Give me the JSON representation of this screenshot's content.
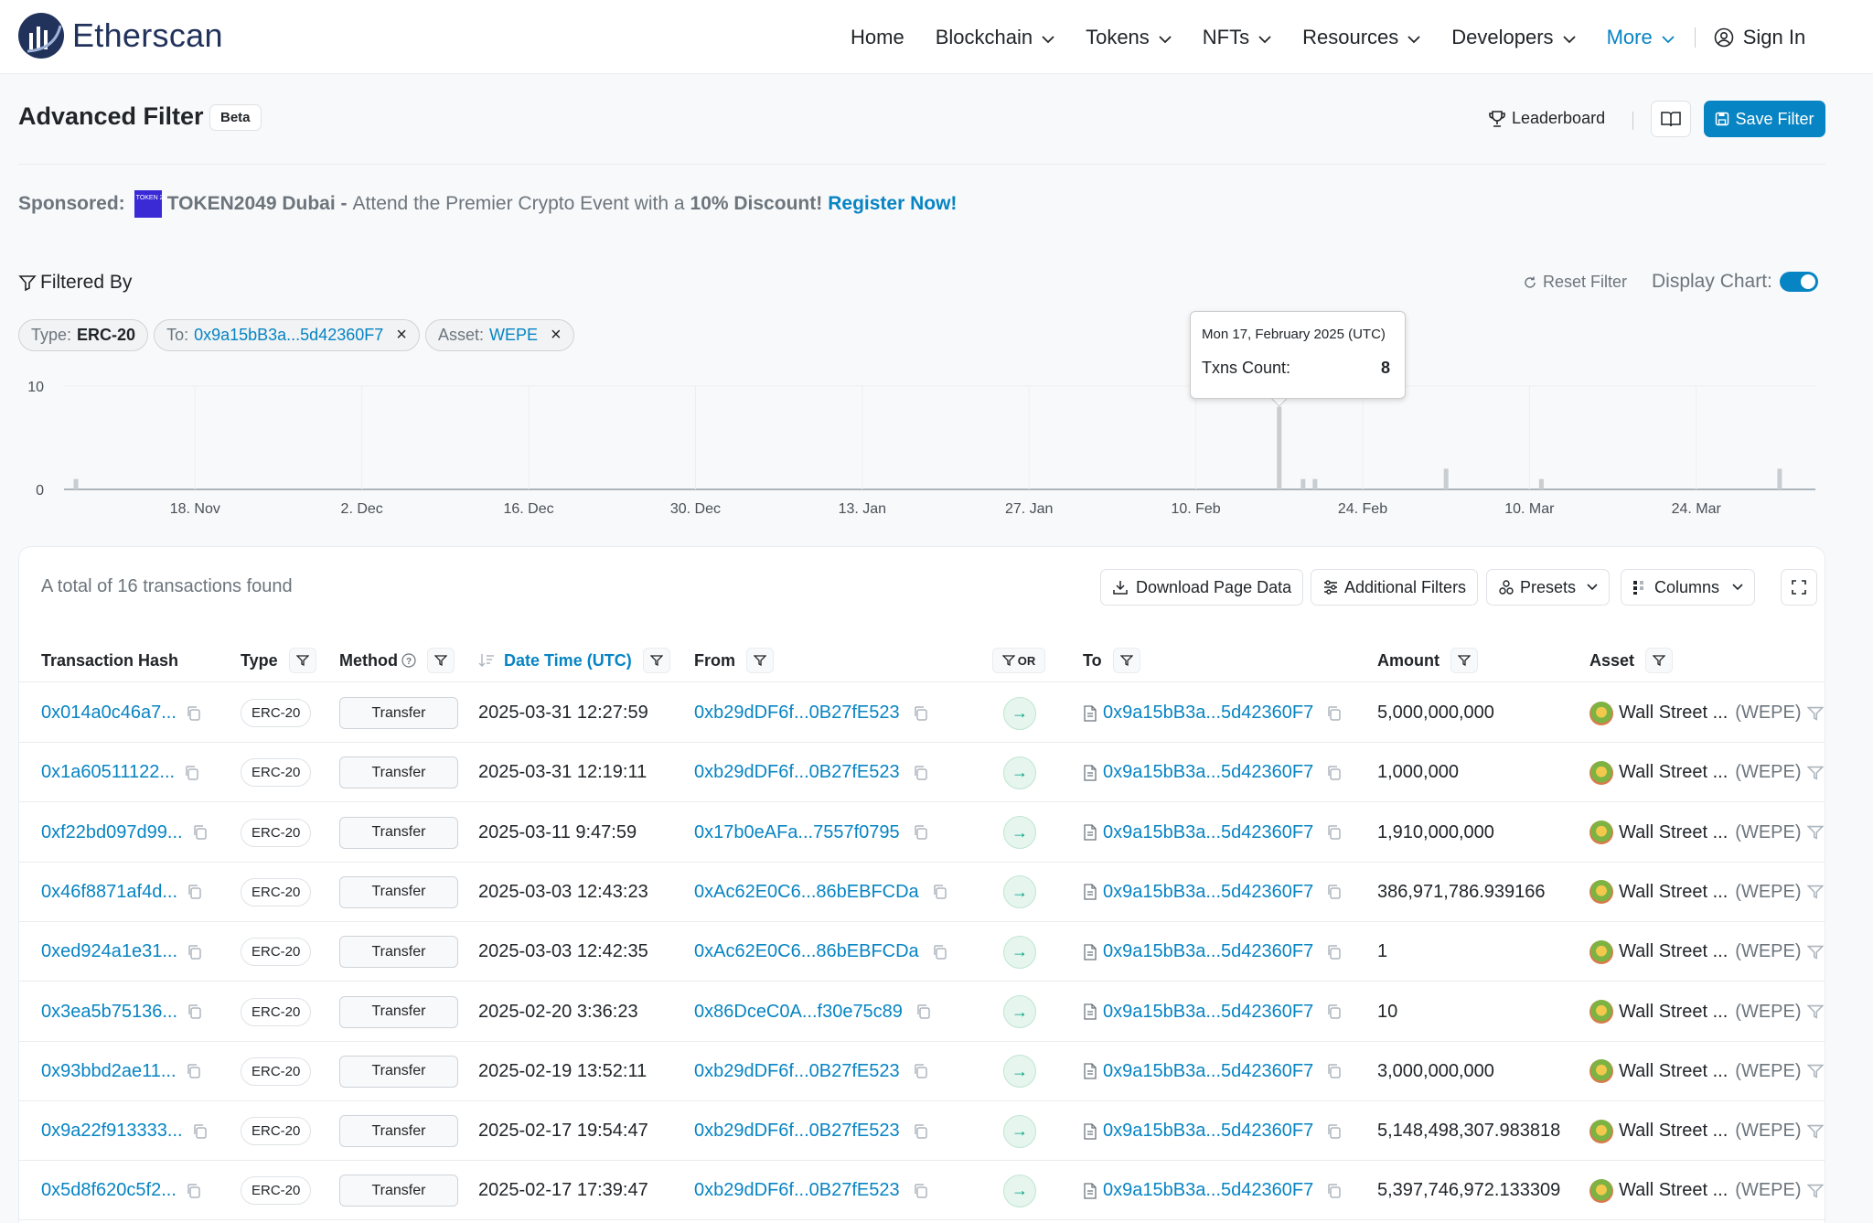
{
  "brand": {
    "name": "Etherscan"
  },
  "nav": {
    "items": [
      {
        "label": "Home",
        "dropdown": false
      },
      {
        "label": "Blockchain",
        "dropdown": true
      },
      {
        "label": "Tokens",
        "dropdown": true
      },
      {
        "label": "NFTs",
        "dropdown": true
      },
      {
        "label": "Resources",
        "dropdown": true
      },
      {
        "label": "Developers",
        "dropdown": true
      },
      {
        "label": "More",
        "dropdown": true,
        "active": true
      }
    ],
    "sign_in": "Sign In"
  },
  "page": {
    "title": "Advanced Filter",
    "badge": "Beta",
    "leaderboard": "Leaderboard",
    "save_filter": "Save Filter"
  },
  "sponsor": {
    "label": "Sponsored:",
    "name": "TOKEN2049 Dubai -",
    "text": "Attend the Premier Crypto Event with a",
    "discount": "10% Discount!",
    "cta": "Register Now!",
    "logo_text": "TOKEN 2049"
  },
  "filters": {
    "heading": "Filtered By",
    "reset": "Reset Filter",
    "display_chart": "Display Chart:",
    "display_chart_on": true,
    "chips": [
      {
        "label": "Type:",
        "value": "ERC-20",
        "removable": false
      },
      {
        "label": "To:",
        "value": "0x9a15bB3a...5d42360F7",
        "removable": true
      },
      {
        "label": "Asset:",
        "value": "WEPE",
        "removable": true
      }
    ]
  },
  "chart_data": {
    "type": "bar",
    "x_tick_labels": [
      "18. Nov",
      "2. Dec",
      "16. Dec",
      "30. Dec",
      "13. Jan",
      "27. Jan",
      "10. Feb",
      "24. Feb",
      "10. Mar",
      "24. Mar"
    ],
    "ylim": [
      0,
      10
    ],
    "y_ticks": [
      0,
      10
    ],
    "x_range": [
      "2024-11-07",
      "2025-04-03"
    ],
    "series": [
      {
        "points": [
          {
            "x": "2024-11-08",
            "y": 1
          },
          {
            "x": "2025-02-17",
            "y": 8
          },
          {
            "x": "2025-02-19",
            "y": 1
          },
          {
            "x": "2025-02-20",
            "y": 1
          },
          {
            "x": "2025-03-03",
            "y": 2
          },
          {
            "x": "2025-03-11",
            "y": 1
          },
          {
            "x": "2025-03-31",
            "y": 2
          }
        ]
      }
    ],
    "tooltip": {
      "title": "Mon 17, February 2025 (UTC)",
      "label": "Txns Count:",
      "value": "8"
    },
    "grid": true
  },
  "table": {
    "total_text": "A total of 16 transactions found",
    "toolbar": {
      "download": "Download Page Data",
      "additional": "Additional Filters",
      "presets": "Presets",
      "columns": "Columns"
    },
    "headers": {
      "hash": "Transaction Hash",
      "type": "Type",
      "method": "Method",
      "datetime": "Date Time (UTC)",
      "from": "From",
      "or": "OR",
      "to": "To",
      "amount": "Amount",
      "asset": "Asset"
    },
    "rows": [
      {
        "hash": "0x014a0c46a7...",
        "type": "ERC-20",
        "method": "Transfer",
        "datetime": "2025-03-31 12:27:59",
        "from": "0xb29dDF6f...0B27fE523",
        "to": "0x9a15bB3a...5d42360F7",
        "amount": "5,000,000,000",
        "asset_name": "Wall Street ...",
        "asset_symbol": "(WEPE)"
      },
      {
        "hash": "0x1a60511122...",
        "type": "ERC-20",
        "method": "Transfer",
        "datetime": "2025-03-31 12:19:11",
        "from": "0xb29dDF6f...0B27fE523",
        "to": "0x9a15bB3a...5d42360F7",
        "amount": "1,000,000",
        "asset_name": "Wall Street ...",
        "asset_symbol": "(WEPE)"
      },
      {
        "hash": "0xf22bd097d99...",
        "type": "ERC-20",
        "method": "Transfer",
        "datetime": "2025-03-11 9:47:59",
        "from": "0x17b0eAFa...7557f0795",
        "to": "0x9a15bB3a...5d42360F7",
        "amount": "1,910,000,000",
        "asset_name": "Wall Street ...",
        "asset_symbol": "(WEPE)"
      },
      {
        "hash": "0x46f8871af4d...",
        "type": "ERC-20",
        "method": "Transfer",
        "datetime": "2025-03-03 12:43:23",
        "from": "0xAc62E0C6...86bEBFCDa",
        "to": "0x9a15bB3a...5d42360F7",
        "amount": "386,971,786.939166",
        "asset_name": "Wall Street ...",
        "asset_symbol": "(WEPE)"
      },
      {
        "hash": "0xed924a1e31...",
        "type": "ERC-20",
        "method": "Transfer",
        "datetime": "2025-03-03 12:42:35",
        "from": "0xAc62E0C6...86bEBFCDa",
        "to": "0x9a15bB3a...5d42360F7",
        "amount": "1",
        "asset_name": "Wall Street ...",
        "asset_symbol": "(WEPE)"
      },
      {
        "hash": "0x3ea5b75136...",
        "type": "ERC-20",
        "method": "Transfer",
        "datetime": "2025-02-20 3:36:23",
        "from": "0x86DceC0A...f30e75c89",
        "to": "0x9a15bB3a...5d42360F7",
        "amount": "10",
        "asset_name": "Wall Street ...",
        "asset_symbol": "(WEPE)"
      },
      {
        "hash": "0x93bbd2ae11...",
        "type": "ERC-20",
        "method": "Transfer",
        "datetime": "2025-02-19 13:52:11",
        "from": "0xb29dDF6f...0B27fE523",
        "to": "0x9a15bB3a...5d42360F7",
        "amount": "3,000,000,000",
        "asset_name": "Wall Street ...",
        "asset_symbol": "(WEPE)"
      },
      {
        "hash": "0x9a22f913333...",
        "type": "ERC-20",
        "method": "Transfer",
        "datetime": "2025-02-17 19:54:47",
        "from": "0xb29dDF6f...0B27fE523",
        "to": "0x9a15bB3a...5d42360F7",
        "amount": "5,148,498,307.983818",
        "asset_name": "Wall Street ...",
        "asset_symbol": "(WEPE)"
      },
      {
        "hash": "0x5d8f620c5f2...",
        "type": "ERC-20",
        "method": "Transfer",
        "datetime": "2025-02-17 17:39:47",
        "from": "0xb29dDF6f...0B27fE523",
        "to": "0x9a15bB3a...5d42360F7",
        "amount": "5,397,746,972.133309",
        "asset_name": "Wall Street ...",
        "asset_symbol": "(WEPE)"
      }
    ]
  },
  "colors": {
    "accent": "#0784c3",
    "brand": "#21325b",
    "success": "#00a186"
  }
}
